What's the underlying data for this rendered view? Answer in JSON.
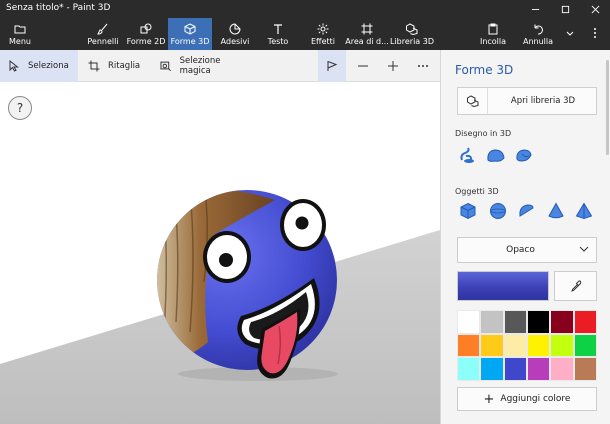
{
  "window": {
    "title": "Senza titolo* - Paint 3D"
  },
  "ribbon": {
    "items": [
      {
        "label": "Menu",
        "icon": "folder-icon"
      },
      {
        "label": "Pennelli",
        "icon": "brush-icon"
      },
      {
        "label": "Forme 2D",
        "icon": "shapes-2d-icon"
      },
      {
        "label": "Forme 3D",
        "icon": "cube-icon",
        "active": true
      },
      {
        "label": "Adesivi",
        "icon": "sticker-icon"
      },
      {
        "label": "Testo",
        "icon": "text-icon"
      },
      {
        "label": "Effetti",
        "icon": "effects-icon"
      },
      {
        "label": "Area di d...",
        "icon": "canvas-icon"
      },
      {
        "label": "Libreria 3D",
        "icon": "library-3d-icon"
      },
      {
        "label": "Incolla",
        "icon": "paste-icon"
      },
      {
        "label": "Annulla",
        "icon": "undo-icon"
      }
    ]
  },
  "toolbar": {
    "select": "Seleziona",
    "crop": "Ritaglia",
    "magic_select": "Selezione magica"
  },
  "canvas": {
    "help": "?"
  },
  "panel": {
    "title": "Forme 3D",
    "library_button": "Apri libreria 3D",
    "doodle_section": "Disegno in 3D",
    "objects_section": "Oggetti 3D",
    "finish_value": "Opaco",
    "current_color": "#3e43b8",
    "add_color": "Aggiungi colore",
    "palette": [
      "#ffffff",
      "#c3c3c3",
      "#585858",
      "#000000",
      "#88001b",
      "#ec1c24",
      "#ff7f27",
      "#ffca18",
      "#fdeca6",
      "#fff200",
      "#c4ff0e",
      "#0ed145",
      "#8cfffb",
      "#00a8f3",
      "#3f48cc",
      "#b83dba",
      "#ffaec8",
      "#b97a56"
    ]
  }
}
